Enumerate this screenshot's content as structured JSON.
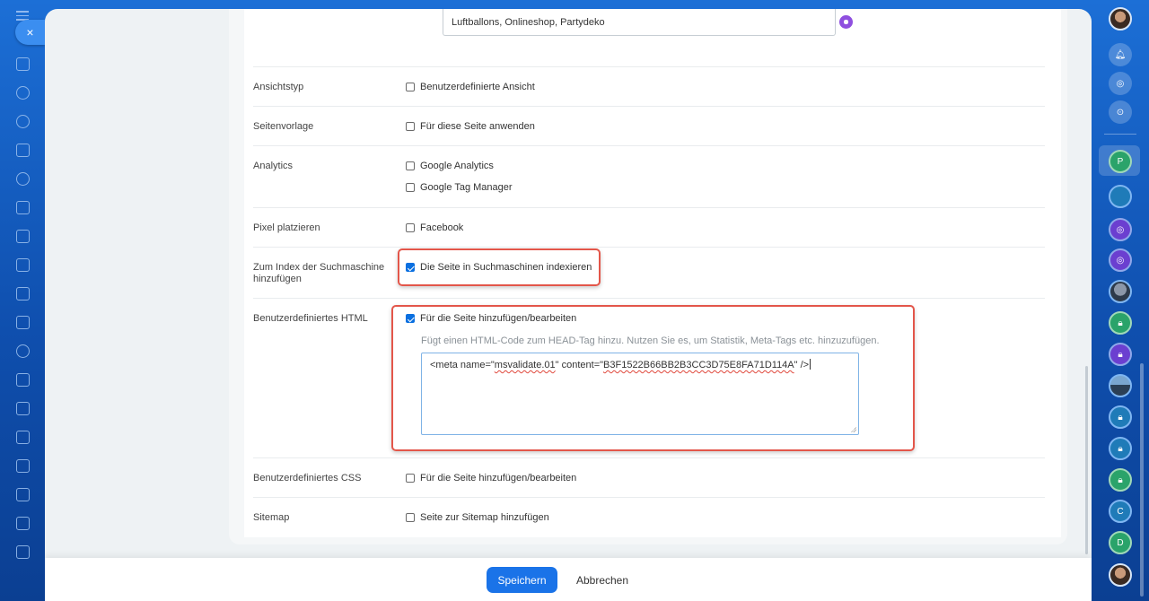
{
  "keywords": {
    "value": "Luftballons, Onlineshop, Partydeko"
  },
  "rows": {
    "ansichtstyp": {
      "label": "Ansichtstyp",
      "option": "Benutzerdefinierte Ansicht",
      "checked": false
    },
    "seitenvorlage": {
      "label": "Seitenvorlage",
      "option": "Für diese Seite anwenden",
      "checked": false
    },
    "analytics": {
      "label": "Analytics",
      "options": [
        "Google Analytics",
        "Google Tag Manager"
      ]
    },
    "pixel": {
      "label": "Pixel platzieren",
      "option": "Facebook",
      "checked": false
    },
    "index": {
      "label": "Zum Index der Suchmaschine hinzufügen",
      "option": "Die Seite in Suchmaschinen indexieren",
      "checked": true
    },
    "custom_html": {
      "label": "Benutzerdefiniertes HTML",
      "option": "Für die Seite hinzufügen/bearbeiten",
      "checked": true,
      "hint": "Fügt einen HTML-Code zum HEAD-Tag hinzu. Nutzen Sie es, um Statistik, Meta-Tags etc. hinzuzufügen.",
      "code_prefix": "<meta name=\"",
      "code_name": "msvalidate.01",
      "code_mid": "\" content=\"",
      "code_value": "B3F1522B66BB2B3CC3D75E8FA71D114A",
      "code_suffix": "\" />"
    },
    "custom_css": {
      "label": "Benutzerdefiniertes CSS",
      "option": "Für die Seite hinzufügen/bearbeiten",
      "checked": false
    },
    "sitemap": {
      "label": "Sitemap",
      "option": "Seite zur Sitemap hinzufügen",
      "checked": false
    }
  },
  "footer": {
    "save_label": "Speichern",
    "cancel_label": "Abbrechen"
  },
  "close_icon": "×",
  "right_rail": {
    "initials": [
      "P",
      "C",
      "D"
    ]
  },
  "colors": {
    "accent": "#1a73e8",
    "highlight": "#e3564a",
    "background": "#1c6fd6"
  }
}
